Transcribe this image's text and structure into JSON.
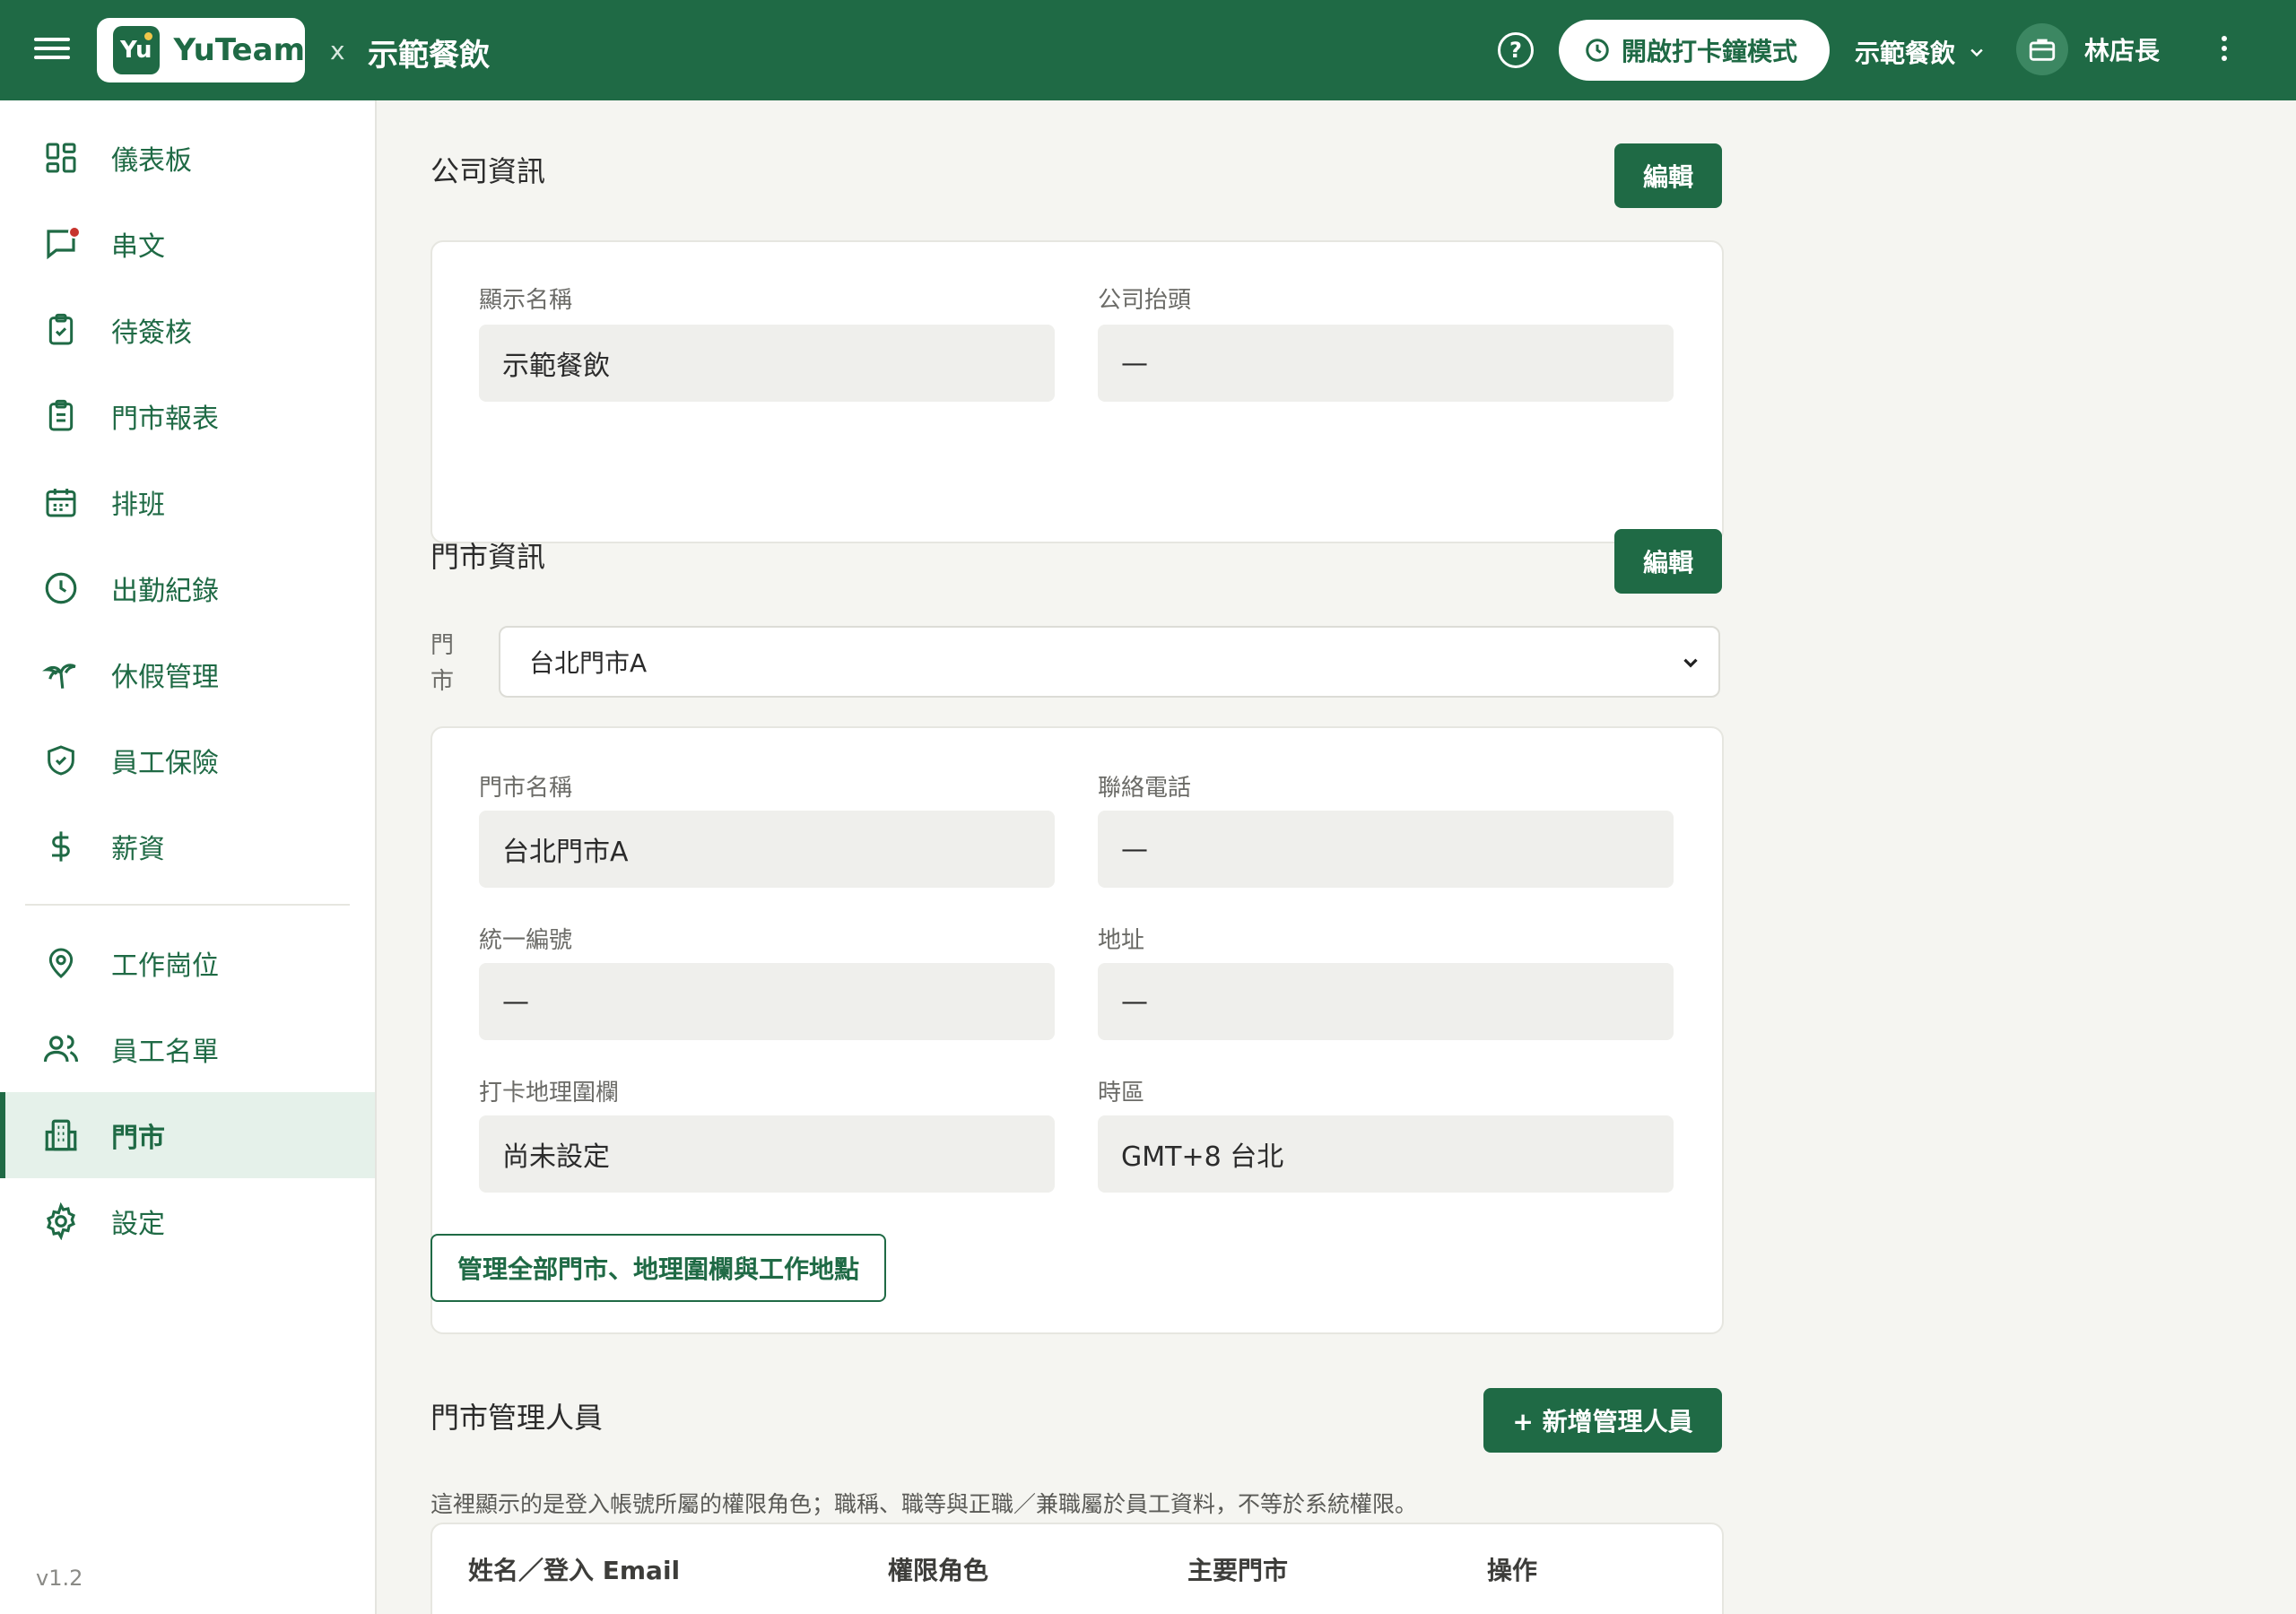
{
  "header": {
    "brand_mark": "Yu",
    "brand_name": "YuTeam",
    "separator": "x",
    "company_name": "示範餐飲",
    "clock_mode_label": "開啟打卡鐘模式",
    "store_switch_label": "示範餐飲",
    "user_name": "林店長"
  },
  "sidebar": {
    "items": [
      {
        "label": "儀表板",
        "icon": "dashboard-icon"
      },
      {
        "label": "串文",
        "icon": "chat-icon"
      },
      {
        "label": "待簽核",
        "icon": "clipboard-check-icon"
      },
      {
        "label": "門市報表",
        "icon": "clipboard-list-icon"
      },
      {
        "label": "排班",
        "icon": "calendar-icon"
      },
      {
        "label": "出勤紀錄",
        "icon": "clock-icon"
      },
      {
        "label": "休假管理",
        "icon": "palm-tree-icon"
      },
      {
        "label": "員工保險",
        "icon": "shield-check-icon"
      },
      {
        "label": "薪資",
        "icon": "dollar-icon"
      },
      {
        "label": "工作崗位",
        "icon": "map-pin-icon"
      },
      {
        "label": "員工名單",
        "icon": "users-icon"
      },
      {
        "label": "門市",
        "icon": "building-icon"
      },
      {
        "label": "設定",
        "icon": "gear-icon"
      }
    ],
    "active": "門市",
    "version": "v1.2"
  },
  "company_section": {
    "title": "公司資訊",
    "edit_label": "編輯",
    "display_name_label": "顯示名稱",
    "display_name_value": "示範餐飲",
    "invoice_title_label": "公司抬頭",
    "invoice_title_value": "—"
  },
  "store_section": {
    "title": "門市資訊",
    "edit_label": "編輯",
    "store_label": "門市",
    "selected_store": "台北門市A",
    "store_name_label": "門市名稱",
    "store_name_value": "台北門市A",
    "phone_label": "聯絡電話",
    "phone_value": "—",
    "tax_id_label": "統一編號",
    "tax_id_value": "—",
    "address_label": "地址",
    "address_value": "—",
    "geofence_label": "打卡地理圍欄",
    "geofence_value": "尚未設定",
    "timezone_label": "時區",
    "timezone_value": "GMT+8 台北",
    "manage_all_label": "管理全部門市、地理圍欄與工作地點"
  },
  "managers_section": {
    "title": "門市管理人員",
    "add_label": "+ 新增管理人員",
    "helper": "這裡顯示的是登入帳號所屬的權限角色；職稱、職等與正職／兼職屬於員工資料，不等於系統權限。",
    "columns": [
      "姓名／登入 Email",
      "權限角色",
      "主要門市",
      "操作"
    ]
  },
  "colors": {
    "brand_green": "#1f6a45",
    "active_bg": "#e5f1ea",
    "notification_dot": "#c7342d"
  }
}
